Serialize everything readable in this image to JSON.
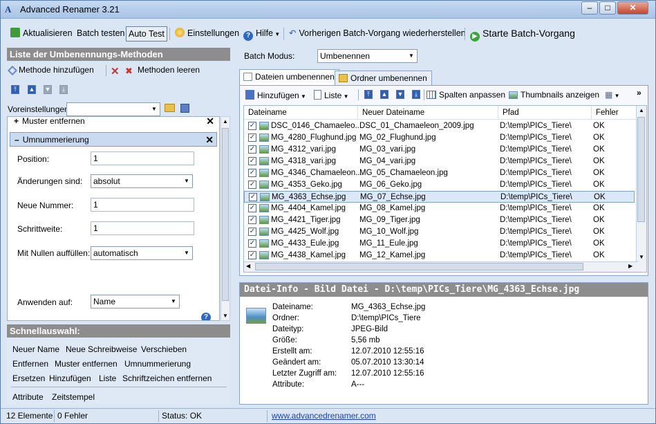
{
  "window": {
    "title": "Advanced Renamer 3.21",
    "minimize": "–",
    "maximize": "□",
    "close": "✕"
  },
  "toolbar": {
    "refresh": "Aktualisieren",
    "batch_test": "Batch testen",
    "auto_test": "Auto Test",
    "settings": "Einstellungen",
    "help": "Hilfe",
    "restore": "Vorherigen Batch-Vorgang wiederherstellen",
    "start": "Starte Batch-Vorgang"
  },
  "methods_panel": {
    "header": "Liste der Umbenennungs-Methoden",
    "add_method": "Methode hinzufügen",
    "clear_methods": "Methoden leeren",
    "presets_label": "Voreinstellungen:",
    "presets_value": ""
  },
  "method_items": [
    {
      "label": "Muster entfernen",
      "expanded": false
    },
    {
      "label": "Umnummerierung",
      "expanded": true
    }
  ],
  "method_form": {
    "position_label": "Position:",
    "position_value": "1",
    "changes_label": "Änderungen sind:",
    "changes_value": "absolut",
    "new_number_label": "Neue Nummer:",
    "new_number_value": "1",
    "step_label": "Schrittweite:",
    "step_value": "1",
    "zeros_label": "Mit Nullen auffüllen:",
    "zeros_value": "automatisch",
    "apply_label": "Anwenden auf:",
    "apply_value": "Name"
  },
  "quick_select": {
    "header": "Schnellauswahl:",
    "rows": [
      [
        "Neuer Name",
        "Neue Schreibweise",
        "Verschieben"
      ],
      [
        "Entfernen",
        "Muster entfernen",
        "Umnummerierung"
      ],
      [
        "Ersetzen",
        "Hinzufügen",
        "Liste",
        "Schriftzeichen entfernen"
      ],
      [
        "Attribute",
        "Zeitstempel"
      ]
    ]
  },
  "batch": {
    "mode_label": "Batch Modus:",
    "mode_value": "Umbenennen"
  },
  "tabs": {
    "files": "Dateien umbenennen",
    "folders": "Ordner umbenennen"
  },
  "list_toolbar": {
    "add": "Hinzufügen",
    "list": "Liste",
    "fit_columns": "Spalten anpassen",
    "thumbnails": "Thumbnails anzeigen"
  },
  "grid": {
    "columns": [
      "Dateiname",
      "Neuer Dateiname",
      "Pfad",
      "Fehler"
    ],
    "rows": [
      [
        "DSC_0146_Chamaeleo...",
        "DSC_01_Chamaeleon_2009.jpg",
        "D:\\temp\\PICs_Tiere\\",
        "OK"
      ],
      [
        "MG_4280_Flughund.jpg",
        "MG_02_Flughund.jpg",
        "D:\\temp\\PICs_Tiere\\",
        "OK"
      ],
      [
        "MG_4312_vari.jpg",
        "MG_03_vari.jpg",
        "D:\\temp\\PICs_Tiere\\",
        "OK"
      ],
      [
        "MG_4318_vari.jpg",
        "MG_04_vari.jpg",
        "D:\\temp\\PICs_Tiere\\",
        "OK"
      ],
      [
        "MG_4346_Chamaeleon...",
        "MG_05_Chamaeleon.jpg",
        "D:\\temp\\PICs_Tiere\\",
        "OK"
      ],
      [
        "MG_4353_Geko.jpg",
        "MG_06_Geko.jpg",
        "D:\\temp\\PICs_Tiere\\",
        "OK"
      ],
      [
        "MG_4363_Echse.jpg",
        "MG_07_Echse.jpg",
        "D:\\temp\\PICs_Tiere\\",
        "OK"
      ],
      [
        "MG_4404_Kamel.jpg",
        "MG_08_Kamel.jpg",
        "D:\\temp\\PICs_Tiere\\",
        "OK"
      ],
      [
        "MG_4421_Tiger.jpg",
        "MG_09_Tiger.jpg",
        "D:\\temp\\PICs_Tiere\\",
        "OK"
      ],
      [
        "MG_4425_Wolf.jpg",
        "MG_10_Wolf.jpg",
        "D:\\temp\\PICs_Tiere\\",
        "OK"
      ],
      [
        "MG_4433_Eule.jpg",
        "MG_11_Eule.jpg",
        "D:\\temp\\PICs_Tiere\\",
        "OK"
      ],
      [
        "MG_4438_Kamel.jpg",
        "MG_12_Kamel.jpg",
        "D:\\temp\\PICs_Tiere\\",
        "OK"
      ]
    ]
  },
  "file_info": {
    "header": "Datei-Info - Bild Datei - D:\\temp\\PICs_Tiere\\MG_4363_Echse.jpg",
    "fields": [
      [
        "Dateiname:",
        "MG_4363_Echse.jpg"
      ],
      [
        "Ordner:",
        "D:\\temp\\PICs_Tiere"
      ],
      [
        "Dateityp:",
        "JPEG-Bild"
      ],
      [
        "Größe:",
        "5,56 mb"
      ],
      [
        "Erstellt am:",
        "12.07.2010 12:55:16"
      ],
      [
        "Geändert am:",
        "05.07.2010 13:30:14"
      ],
      [
        "Letzter Zugriff am:",
        "12.07.2010 12:55:16"
      ],
      [
        "Attribute:",
        "A---"
      ]
    ]
  },
  "statusbar": {
    "count": "12 Elemente",
    "errors": "0 Fehler",
    "status": "Status: OK",
    "link": "www.advancedrenamer.com"
  }
}
